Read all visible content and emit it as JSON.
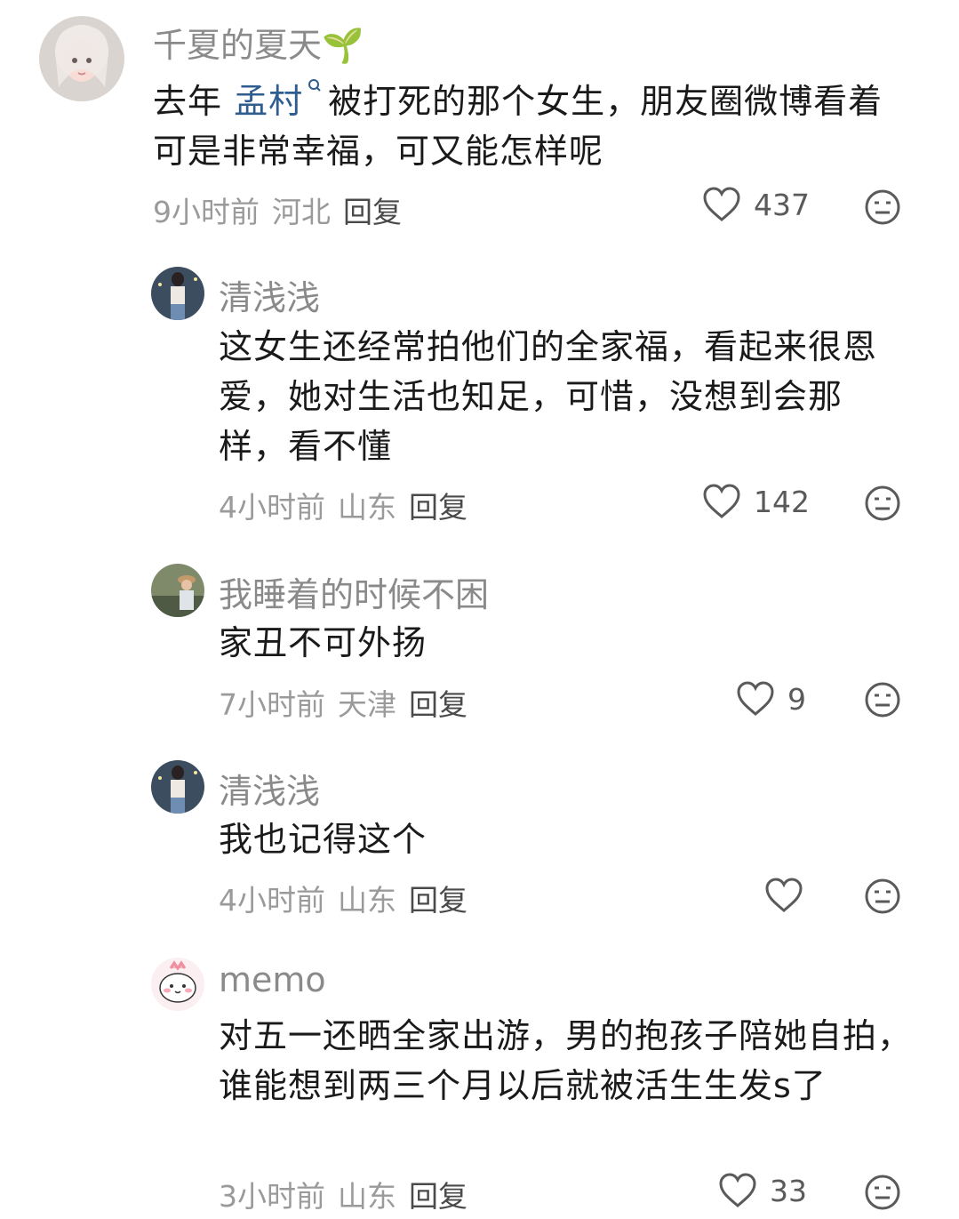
{
  "comments": [
    {
      "username": "千夏的夏天🌱",
      "text_before": "去年",
      "link": "孟村",
      "text_after": "被打死的那个女生，朋友圈微博看着可是非常幸福，可又能怎样呢",
      "time": "9小时前",
      "location": "河北",
      "reply": "回复",
      "likes": "437"
    },
    {
      "username": "清浅浅",
      "text": "这女生还经常拍他们的全家福，看起来很恩爱，她对生活也知足，可惜，没想到会那样，看不懂",
      "time": "4小时前",
      "location": "山东",
      "reply": "回复",
      "likes": "142"
    },
    {
      "username": "我睡着的时候不困",
      "text": "家丑不可外扬",
      "time": "7小时前",
      "location": "天津",
      "reply": "回复",
      "likes": "9"
    },
    {
      "username": "清浅浅",
      "text": "我也记得这个",
      "time": "4小时前",
      "location": "山东",
      "reply": "回复",
      "likes": ""
    },
    {
      "username": "memo",
      "text": "对五一还晒全家出游，男的抱孩子陪她自拍，谁能想到两三个月以后就被活生生发s了",
      "time": "3小时前",
      "location": "山东",
      "reply": "回复",
      "likes": "33"
    }
  ],
  "icons": {
    "like": "heart-outline-icon",
    "dislike": "meh-face-icon",
    "search": "search-icon"
  },
  "colors": {
    "link": "#2f5d8f",
    "username": "#8a8a8a",
    "meta": "#9a9a9a"
  }
}
